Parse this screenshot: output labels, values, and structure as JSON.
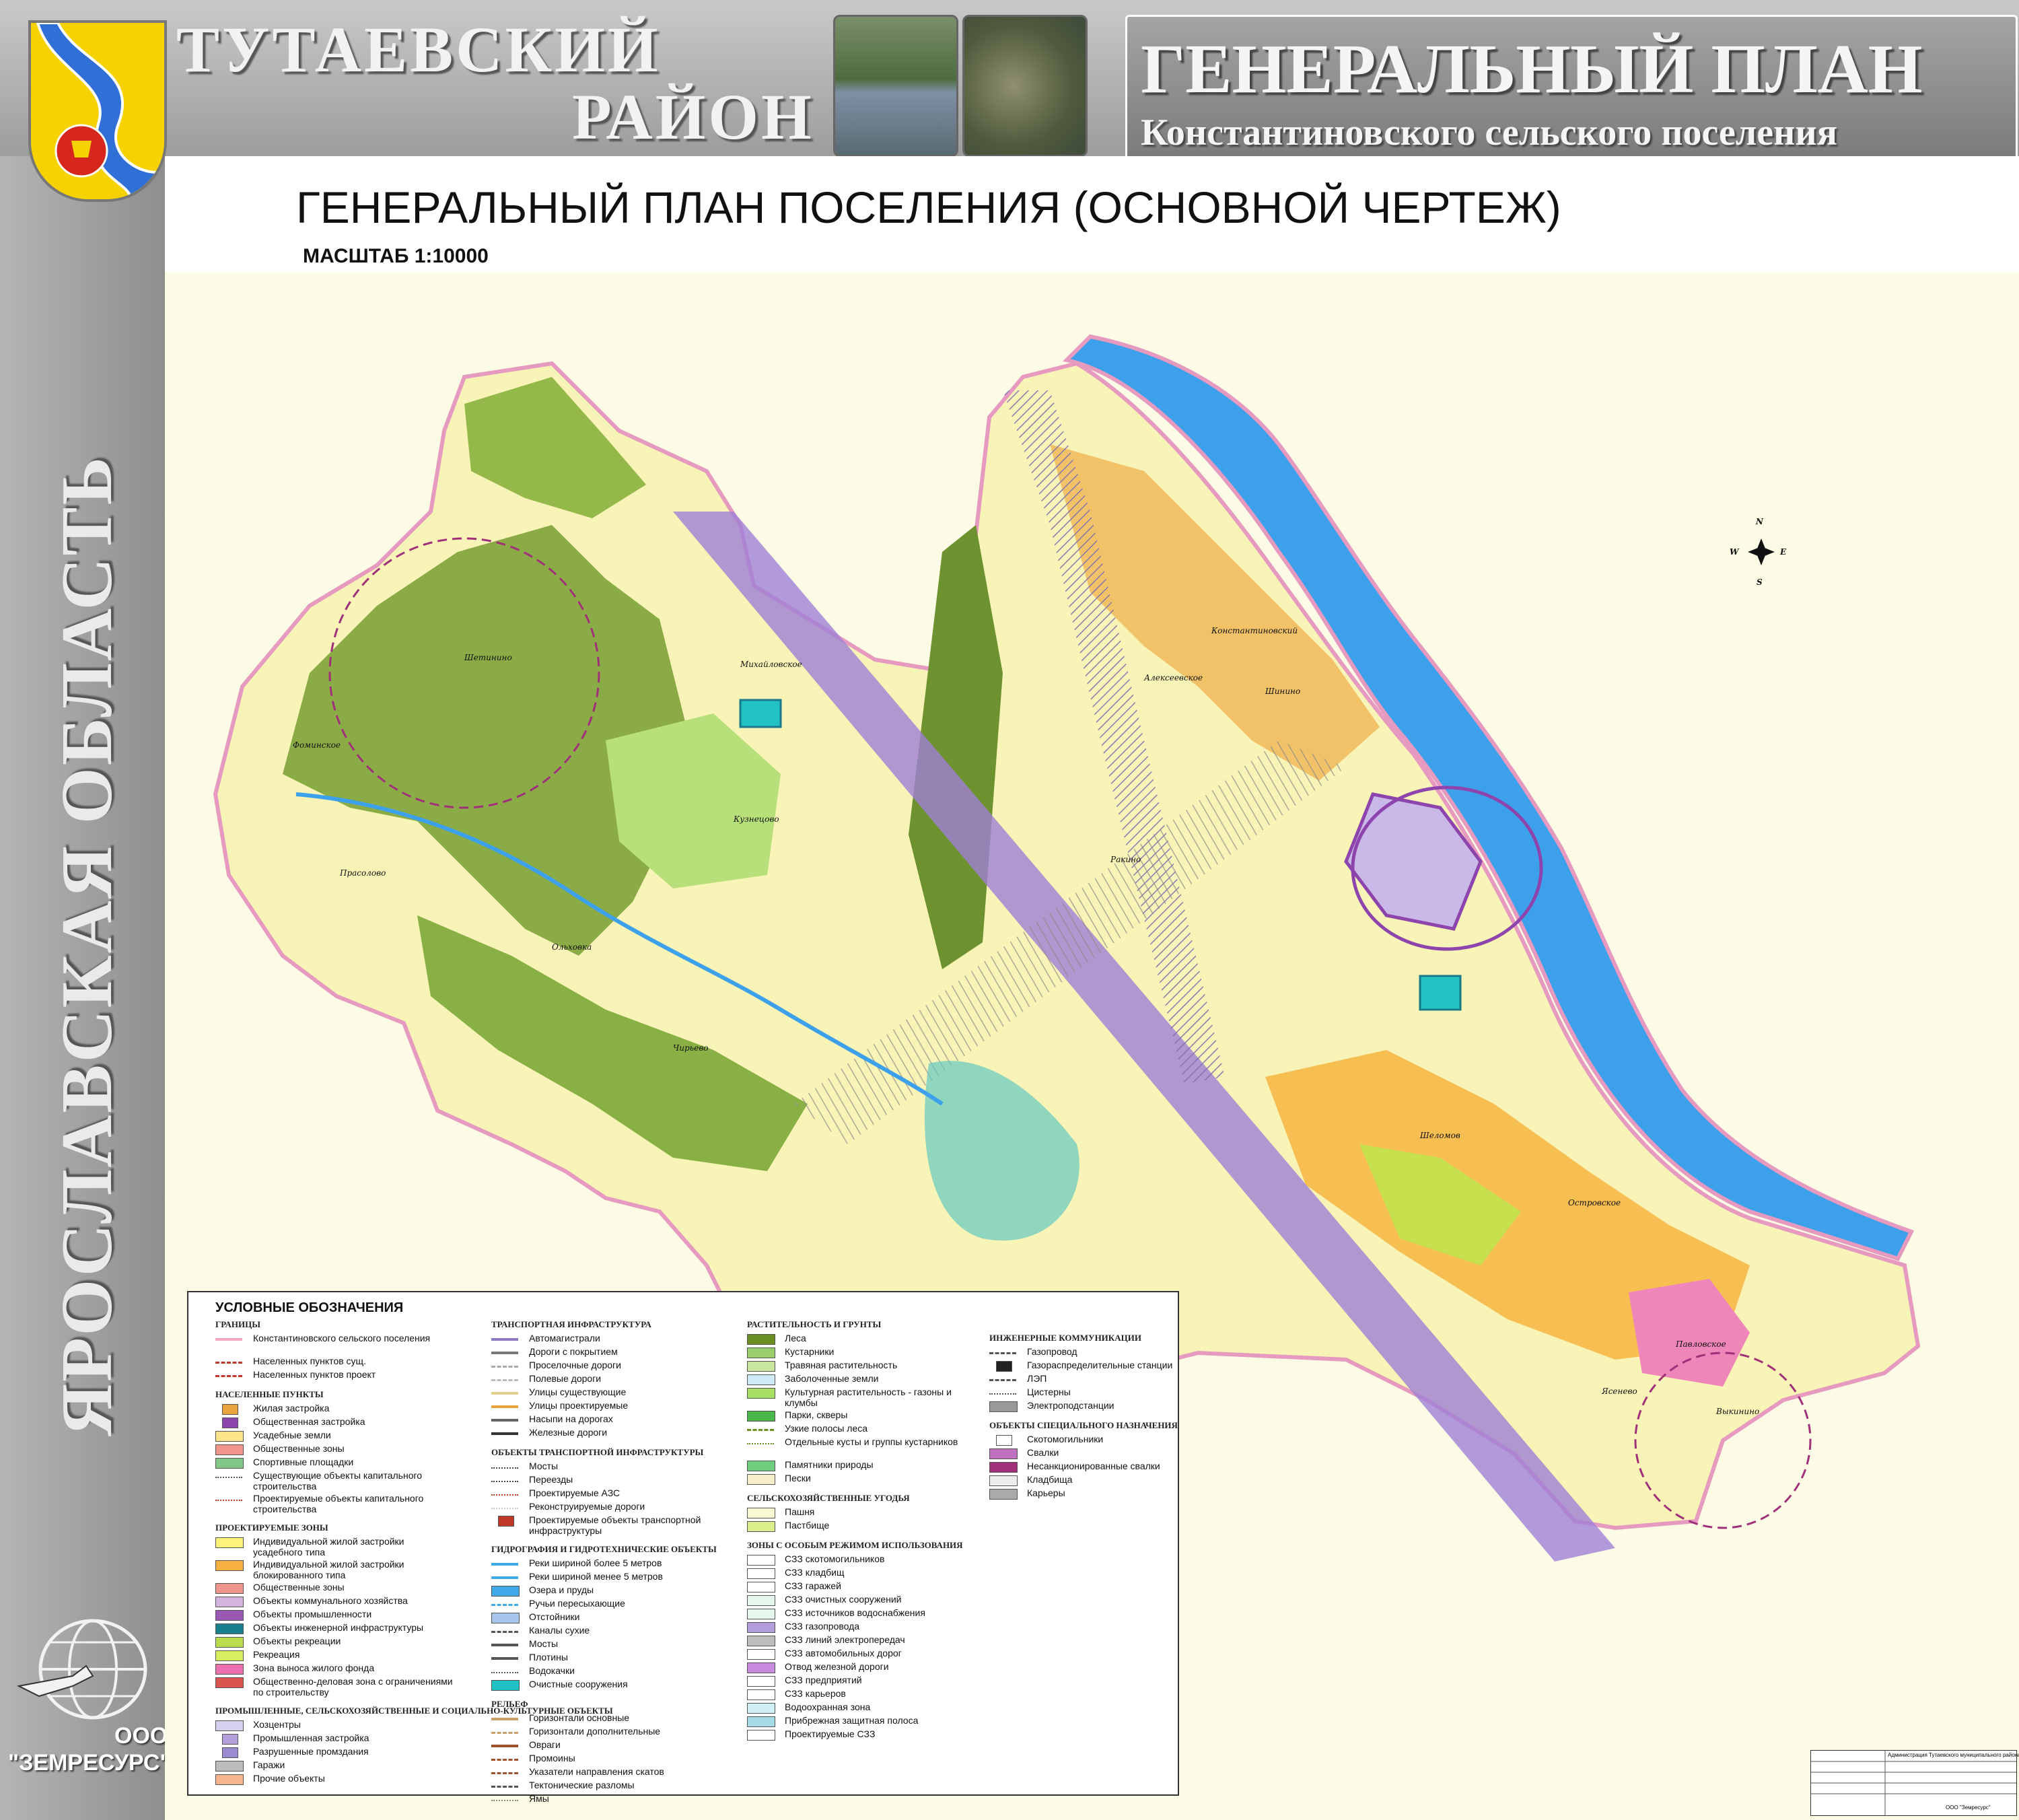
{
  "header": {
    "district_line1": "ТУТАЕВСКИЙ",
    "district_line2": "РАЙОН",
    "plan_title": "ГЕНЕРАЛЬНЫЙ ПЛАН",
    "plan_subtitle": "Константиновского сельского поселения"
  },
  "side_strip": {
    "region": "ЯРОСЛАВСКАЯ ОБЛАСТЬ",
    "company_prefix": "ООО",
    "company_name": "\"ЗЕМРЕСУРС\""
  },
  "sheet": {
    "title": "ГЕНЕРАЛЬНЫЙ ПЛАН ПОСЕЛЕНИЯ (ОСНОВНОЙ ЧЕРТЕЖ)",
    "scale": "МАСШТАБ 1:10000"
  },
  "compass": {
    "n": "N",
    "s": "S",
    "e": "E",
    "w": "W"
  },
  "place_labels": [
    "Фоминское",
    "Прасолово",
    "Шетинино",
    "Михайловское",
    "Кузнецово",
    "Ольховка",
    "Чирьево",
    "Алексеевское",
    "Константиновский",
    "Шинино",
    "Ракино",
    "Островское",
    "Шеломов",
    "Павловское",
    "Ясенево",
    "Выкинино"
  ],
  "legend": {
    "heading": "УСЛОВНЫЕ ОБОЗНАЧЕНИЯ",
    "columns": [
      [
        {
          "section": "ГРАНИЦЫ",
          "items": [
            {
              "label": "Константиновского сельского поселения",
              "color": "#f2a7c3",
              "kind": "line"
            },
            {
              "label": "Населенных пунктов сущ.",
              "color": "#c0392b",
              "kind": "dash"
            },
            {
              "label": "Населенных пунктов проект",
              "color": "#c0392b",
              "kind": "dash"
            }
          ]
        },
        {
          "section": "НАСЕЛЕННЫЕ ПУНКТЫ",
          "items": [
            {
              "label": "Жилая застройка",
              "color": "#e8a33c",
              "kind": "icon"
            },
            {
              "label": "Общественная застройка",
              "color": "#8e44ad",
              "kind": "icon"
            },
            {
              "label": "Усадебные земли",
              "color": "#fce58a",
              "kind": "box"
            },
            {
              "label": "Общественные зоны",
              "color": "#f1948a",
              "kind": "box"
            },
            {
              "label": "Спортивные площадки",
              "color": "#82c785",
              "kind": "box"
            },
            {
              "label": "Существующие объекты капитального строительства",
              "color": "#555555",
              "kind": "text"
            },
            {
              "label": "Проектируемые объекты капитального строительства",
              "color": "#c0392b",
              "kind": "text"
            }
          ]
        },
        {
          "section": "ПРОЕКТИРУЕМЫЕ ЗОНЫ",
          "items": [
            {
              "label": "Индивидуальной жилой застройки усадебного типа",
              "color": "#fff27a",
              "kind": "box"
            },
            {
              "label": "Индивидуальной жилой застройки блокированного типа",
              "color": "#f5b041",
              "kind": "box"
            },
            {
              "label": "Общественные зоны",
              "color": "#f1948a",
              "kind": "box"
            },
            {
              "label": "Объекты коммунального хозяйства",
              "color": "#d2b4de",
              "kind": "box"
            },
            {
              "label": "Объекты промышленности",
              "color": "#9b59b6",
              "kind": "box"
            },
            {
              "label": "Объекты инженерной инфраструктуры",
              "color": "#17808c",
              "kind": "box"
            },
            {
              "label": "Объекты рекреации",
              "color": "#b7dd4f",
              "kind": "box"
            },
            {
              "label": "Рекреация",
              "color": "#d6ef5e",
              "kind": "box"
            },
            {
              "label": "Зона выноса жилого фонда",
              "color": "#ec6fb0",
              "kind": "box"
            },
            {
              "label": "Общественно-деловая зона с ограничениями по строительству",
              "color": "#d9534f",
              "kind": "box"
            }
          ]
        },
        {
          "section": "ПРОМЫШЛЕННЫЕ, СЕЛЬСКОХОЗЯЙСТВЕННЫЕ И СОЦИАЛЬНО-КУЛЬТУРНЫЕ ОБЪЕКТЫ",
          "items": [
            {
              "label": "Хозцентры",
              "color": "#d6d0f0",
              "kind": "box"
            },
            {
              "label": "Промышленная застройка",
              "color": "#b39ddb",
              "kind": "icon"
            },
            {
              "label": "Разрушенные промздания",
              "color": "#9b8ad1",
              "kind": "icon"
            },
            {
              "label": "Гаражи",
              "color": "#bdbdbd",
              "kind": "box"
            },
            {
              "label": "Прочие объекты",
              "color": "#f6b48f",
              "kind": "box"
            }
          ]
        }
      ],
      [
        {
          "section": "ТРАНСПОРТНАЯ ИНФРАСТРУКТУРА",
          "items": [
            {
              "label": "Автомагистрали",
              "color": "#8e7cc3",
              "kind": "line"
            },
            {
              "label": "Дороги с покрытием",
              "color": "#777777",
              "kind": "line"
            },
            {
              "label": "Проселочные дороги",
              "color": "#aaaaaa",
              "kind": "dash"
            },
            {
              "label": "Полевые дороги",
              "color": "#bbbbbb",
              "kind": "dash"
            },
            {
              "label": "Улицы существующие",
              "color": "#e0d28c",
              "kind": "line"
            },
            {
              "label": "Улицы проектируемые",
              "color": "#e8a33c",
              "kind": "line"
            },
            {
              "label": "Насыпи на дорогах",
              "color": "#666666",
              "kind": "line"
            },
            {
              "label": "Железные дороги",
              "color": "#333333",
              "kind": "line"
            }
          ]
        },
        {
          "section": "ОБЪЕКТЫ ТРАНСПОРТНОЙ ИНФРАСТРУКТУРЫ",
          "items": [
            {
              "label": "Мосты",
              "color": "#444444",
              "kind": "text"
            },
            {
              "label": "Переезды",
              "color": "#444444",
              "kind": "text"
            },
            {
              "label": "Проектируемые АЗС",
              "color": "#c0392b",
              "kind": "text"
            },
            {
              "label": "Реконструируемые дороги",
              "color": "#cccccc",
              "kind": "text"
            },
            {
              "label": "Проектируемые объекты транспортной инфраструктуры",
              "color": "#c0392b",
              "kind": "icon"
            }
          ]
        },
        {
          "section": "ГИДРОГРАФИЯ И ГИДРОТЕХНИЧЕСКИЕ ОБЪЕКТЫ",
          "items": [
            {
              "label": "Реки шириной более 5 метров",
              "color": "#3fa9e8",
              "kind": "line"
            },
            {
              "label": "Реки шириной менее 5 метров",
              "color": "#3fa9e8",
              "kind": "line"
            },
            {
              "label": "Озера и пруды",
              "color": "#3fa9e8",
              "kind": "box"
            },
            {
              "label": "Ручьи пересыхающие",
              "color": "#3fa9e8",
              "kind": "dash"
            },
            {
              "label": "Отстойники",
              "color": "#a8c4ec",
              "kind": "box"
            },
            {
              "label": "Каналы сухие",
              "color": "#555555",
              "kind": "dash"
            },
            {
              "label": "Мосты",
              "color": "#555555",
              "kind": "line"
            },
            {
              "label": "Плотины",
              "color": "#555555",
              "kind": "line"
            },
            {
              "label": "Водокачки",
              "color": "#555555",
              "kind": "text"
            },
            {
              "label": "Очистные сооружения",
              "color": "#22c1c3",
              "kind": "box"
            }
          ]
        },
        {
          "section": "РЕЛЬЕФ",
          "items": [
            {
              "label": "Горизонтали основные",
              "color": "#c8a06b",
              "kind": "line"
            },
            {
              "label": "Горизонтали дополнительные",
              "color": "#c8a06b",
              "kind": "dash"
            },
            {
              "label": "Овраги",
              "color": "#a0522d",
              "kind": "line"
            },
            {
              "label": "Промоины",
              "color": "#a0522d",
              "kind": "dash"
            },
            {
              "label": "Указатели направления скатов",
              "color": "#a0522d",
              "kind": "dash"
            },
            {
              "label": "Тектонические разломы",
              "color": "#555555",
              "kind": "dash"
            },
            {
              "label": "Ямы",
              "color": "#888888",
              "kind": "text"
            }
          ]
        }
      ],
      [
        {
          "section": "РАСТИТЕЛЬНОСТЬ И ГРУНТЫ",
          "items": [
            {
              "label": "Леса",
              "color": "#6b8e23",
              "kind": "box"
            },
            {
              "label": "Кустарники",
              "color": "#9acd6b",
              "kind": "box"
            },
            {
              "label": "Травяная растительность",
              "color": "#c8e6a0",
              "kind": "box"
            },
            {
              "label": "Заболоченные земли",
              "color": "#cfe9f5",
              "kind": "box"
            },
            {
              "label": "Культурная растительность - газоны и клумбы",
              "color": "#a8e063",
              "kind": "box"
            },
            {
              "label": "Парки, скверы",
              "color": "#48b848",
              "kind": "box"
            },
            {
              "label": "Узкие полосы леса",
              "color": "#6b8e23",
              "kind": "dash"
            },
            {
              "label": "Отдельные кусты и группы кустарников",
              "color": "#6b8e23",
              "kind": "text"
            },
            {
              "label": "Памятники природы",
              "color": "#6fcf7f",
              "kind": "box"
            },
            {
              "label": "Пески",
              "color": "#f5eec8",
              "kind": "box"
            }
          ]
        },
        {
          "section": "СЕЛЬСКОХОЗЯЙСТВЕННЫЕ УГОДЬЯ",
          "items": [
            {
              "label": "Пашня",
              "color": "#fafad2",
              "kind": "box"
            },
            {
              "label": "Пастбище",
              "color": "#d9f08a",
              "kind": "box"
            }
          ]
        },
        {
          "section": "ЗОНЫ С ОСОБЫМ РЕЖИМОМ ИСПОЛЬЗОВАНИЯ",
          "items": [
            {
              "label": "СЗЗ скотомогильников",
              "color": "#ffffff",
              "kind": "box"
            },
            {
              "label": "СЗЗ кладбищ",
              "color": "#ffffff",
              "kind": "box"
            },
            {
              "label": "СЗЗ гаражей",
              "color": "#ffffff",
              "kind": "box"
            },
            {
              "label": "СЗЗ очистных сооружений",
              "color": "#e6f7ee",
              "kind": "box"
            },
            {
              "label": "СЗЗ источников водоснабжения",
              "color": "#e6f7ee",
              "kind": "box"
            },
            {
              "label": "СЗЗ газопровода",
              "color": "#b39ddb",
              "kind": "box"
            },
            {
              "label": "СЗЗ линий электропередач",
              "color": "#bdbdbd",
              "kind": "box"
            },
            {
              "label": "СЗЗ автомобильных дорог",
              "color": "#ffffff",
              "kind": "box"
            },
            {
              "label": "Отвод железной дороги",
              "color": "#c98be0",
              "kind": "box"
            },
            {
              "label": "СЗЗ предприятий",
              "color": "#ffffff",
              "kind": "box"
            },
            {
              "label": "СЗЗ карьеров",
              "color": "#ffffff",
              "kind": "box"
            },
            {
              "label": "Водоохранная зона",
              "color": "#d0f0f5",
              "kind": "box"
            },
            {
              "label": "Прибрежная защитная полоса",
              "color": "#a5dce8",
              "kind": "box"
            },
            {
              "label": "Проектируемые СЗЗ",
              "color": "#ffffff",
              "kind": "box"
            }
          ]
        }
      ],
      [
        {
          "section": "ИНЖЕНЕРНЫЕ КОММУНИКАЦИИ",
          "items": [
            {
              "label": "Газопровод",
              "color": "#555555",
              "kind": "dash"
            },
            {
              "label": "Газораспределительные станции",
              "color": "#222222",
              "kind": "icon"
            },
            {
              "label": "ЛЭП",
              "color": "#555555",
              "kind": "dash"
            },
            {
              "label": "Цистерны",
              "color": "#555555",
              "kind": "text"
            },
            {
              "label": "Электроподстанции",
              "color": "#999999",
              "kind": "box"
            }
          ]
        },
        {
          "section": "ОБЪЕКТЫ СПЕЦИАЛЬНОГО НАЗНАЧЕНИЯ",
          "items": [
            {
              "label": "Скотомогильники",
              "color": "#ffffff",
              "kind": "icon"
            },
            {
              "label": "Свалки",
              "color": "#c070c0",
              "kind": "box"
            },
            {
              "label": "Несанкционированные свалки",
              "color": "#a0307a",
              "kind": "box"
            },
            {
              "label": "Кладбища",
              "color": "#eeeeee",
              "kind": "box"
            },
            {
              "label": "Карьеры",
              "color": "#aaaaaa",
              "kind": "box"
            }
          ]
        }
      ]
    ]
  },
  "stamp": {
    "line1": "Администрация Тутаевского муниципального района",
    "line2": "ООО \"Земресурс\""
  }
}
